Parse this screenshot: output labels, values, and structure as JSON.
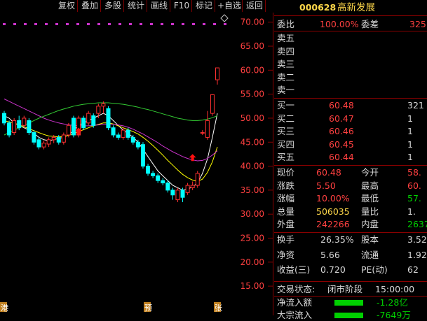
{
  "toolbar": {
    "buttons": [
      "复权",
      "叠加",
      "多股",
      "统计",
      "画线",
      "F10",
      "标记",
      "+自选",
      "返回"
    ]
  },
  "stock": {
    "code": "000628",
    "name": "高新发展"
  },
  "order_book": {
    "webi_label": "委比",
    "webi_value": "100.00%",
    "weicha_label": "委差",
    "weicha_value": "325",
    "asks": [
      {
        "label": "卖五",
        "price": "",
        "vol": ""
      },
      {
        "label": "卖四",
        "price": "",
        "vol": ""
      },
      {
        "label": "卖三",
        "price": "",
        "vol": ""
      },
      {
        "label": "卖二",
        "price": "",
        "vol": ""
      },
      {
        "label": "卖一",
        "price": "",
        "vol": ""
      }
    ],
    "bids": [
      {
        "label": "买一",
        "price": "60.48",
        "vol": "321"
      },
      {
        "label": "买二",
        "price": "60.47",
        "vol": "1"
      },
      {
        "label": "买三",
        "price": "60.46",
        "vol": "1"
      },
      {
        "label": "买四",
        "price": "60.45",
        "vol": "1"
      },
      {
        "label": "买五",
        "price": "60.44",
        "vol": "1"
      }
    ]
  },
  "quote": {
    "rows": [
      {
        "l1": "现价",
        "v1": "60.48",
        "l2": "今开",
        "v2": "58."
      },
      {
        "l1": "涨跌",
        "v1": "5.50",
        "l2": "最高",
        "v2": "60."
      },
      {
        "l1": "涨幅",
        "v1": "10.00%",
        "l2": "最低",
        "v2": "57."
      },
      {
        "l1": "总量",
        "v1": "506035",
        "l2": "量比",
        "v2": "1."
      },
      {
        "l1": "外盘",
        "v1": "242266",
        "l2": "内盘",
        "v2": "2637"
      }
    ]
  },
  "finance": {
    "rows": [
      {
        "l1": "换手",
        "v1": "26.35%",
        "l2": "股本",
        "v2": "3.52"
      },
      {
        "l1": "净资",
        "v1": "5.66",
        "l2": "流通",
        "v2": "1.92"
      },
      {
        "l1": "收益(三)",
        "v1": "0.720",
        "l2": "PE(动)",
        "v2": "62"
      }
    ]
  },
  "status": {
    "label": "交易状态:",
    "state": "闭市阶段",
    "time": "15:00:00"
  },
  "flows": [
    {
      "label": "净流入额",
      "value": "-1.28亿",
      "bar": 0.45
    },
    {
      "label": "大宗流入",
      "value": "-7649万",
      "bar": 0.45
    }
  ],
  "colors": {
    "up": "#ff3030",
    "down": "#00ffff",
    "ma5": "#ffffff",
    "ma10": "#ffff00",
    "ma20": "#cc33cc",
    "ma60": "#33cc33",
    "axis": "#8a0000"
  },
  "chart_data": {
    "type": "candlestick",
    "y_ticks": [
      "70.00",
      "65.00",
      "60.00",
      "55.00",
      "50.00",
      "45.00",
      "40.00",
      "35.00",
      "30.00",
      "25.00",
      "20.00",
      "15.00"
    ],
    "ylim": [
      14,
      72
    ],
    "bottom_labels": [
      "港",
      "预",
      "张"
    ],
    "candles": [
      {
        "o": 51.0,
        "c": 49.0,
        "h": 51.5,
        "l": 48.5
      },
      {
        "o": 49.0,
        "c": 46.5,
        "h": 49.5,
        "l": 46.0
      },
      {
        "o": 47.0,
        "c": 49.5,
        "h": 50.0,
        "l": 46.5
      },
      {
        "o": 49.5,
        "c": 48.0,
        "h": 50.5,
        "l": 47.5
      },
      {
        "o": 48.5,
        "c": 50.0,
        "h": 50.5,
        "l": 48.0
      },
      {
        "o": 49.5,
        "c": 47.0,
        "h": 50.0,
        "l": 46.5
      },
      {
        "o": 47.0,
        "c": 45.0,
        "h": 47.5,
        "l": 44.5
      },
      {
        "o": 45.5,
        "c": 44.0,
        "h": 46.0,
        "l": 43.5
      },
      {
        "o": 44.0,
        "c": 44.8,
        "h": 45.3,
        "l": 43.5
      },
      {
        "o": 44.6,
        "c": 45.5,
        "h": 46.0,
        "l": 44.0
      },
      {
        "o": 45.5,
        "c": 46.0,
        "h": 46.5,
        "l": 44.8
      },
      {
        "o": 46.0,
        "c": 45.0,
        "h": 46.5,
        "l": 44.5
      },
      {
        "o": 45.0,
        "c": 46.5,
        "h": 47.0,
        "l": 44.5
      },
      {
        "o": 46.5,
        "c": 48.5,
        "h": 49.0,
        "l": 46.0
      },
      {
        "o": 50.0,
        "c": 46.5,
        "h": 50.5,
        "l": 46.0
      },
      {
        "o": 46.5,
        "c": 50.0,
        "h": 50.5,
        "l": 46.0
      },
      {
        "o": 50.0,
        "c": 48.0,
        "h": 50.5,
        "l": 47.5
      },
      {
        "o": 49.0,
        "c": 51.0,
        "h": 51.5,
        "l": 48.5
      },
      {
        "o": 50.5,
        "c": 48.5,
        "h": 51.0,
        "l": 48.0
      },
      {
        "o": 51.0,
        "c": 52.5,
        "h": 53.0,
        "l": 50.0
      },
      {
        "o": 52.5,
        "c": 53.0,
        "h": 53.5,
        "l": 51.0
      },
      {
        "o": 52.0,
        "c": 48.0,
        "h": 52.5,
        "l": 47.5
      },
      {
        "o": 48.0,
        "c": 46.5,
        "h": 48.5,
        "l": 46.0
      },
      {
        "o": 46.5,
        "c": 46.0,
        "h": 47.0,
        "l": 45.5
      },
      {
        "o": 46.0,
        "c": 47.5,
        "h": 48.0,
        "l": 45.5
      },
      {
        "o": 47.5,
        "c": 46.0,
        "h": 48.0,
        "l": 45.5
      },
      {
        "o": 46.0,
        "c": 45.0,
        "h": 46.5,
        "l": 44.5
      },
      {
        "o": 45.0,
        "c": 44.0,
        "h": 45.5,
        "l": 43.5
      },
      {
        "o": 44.5,
        "c": 40.0,
        "h": 45.0,
        "l": 39.5
      },
      {
        "o": 40.0,
        "c": 38.5,
        "h": 40.5,
        "l": 38.0
      },
      {
        "o": 38.5,
        "c": 38.0,
        "h": 39.0,
        "l": 37.5
      },
      {
        "o": 38.0,
        "c": 37.0,
        "h": 38.5,
        "l": 36.5
      },
      {
        "o": 37.0,
        "c": 36.5,
        "h": 37.5,
        "l": 36.0
      },
      {
        "o": 36.5,
        "c": 35.0,
        "h": 37.0,
        "l": 34.5
      },
      {
        "o": 35.0,
        "c": 34.0,
        "h": 35.5,
        "l": 33.0
      },
      {
        "o": 33.0,
        "c": 35.0,
        "h": 35.5,
        "l": 32.5
      },
      {
        "o": 35.0,
        "c": 33.5,
        "h": 35.5,
        "l": 32.5
      },
      {
        "o": 34.5,
        "c": 36.0,
        "h": 36.5,
        "l": 34.0
      },
      {
        "o": 35.5,
        "c": 36.0,
        "h": 36.8,
        "l": 35.0
      },
      {
        "o": 36.0,
        "c": 38.5,
        "h": 39.0,
        "l": 35.5
      },
      {
        "o": 47.0,
        "c": 47.0,
        "h": 47.5,
        "l": 46.5
      },
      {
        "o": 46.0,
        "c": 49.5,
        "h": 51.5,
        "l": 45.5
      },
      {
        "o": 51.0,
        "c": 54.9,
        "h": 55.0,
        "l": 50.5
      },
      {
        "o": 58.0,
        "c": 60.48,
        "h": 60.48,
        "l": 57.0
      }
    ],
    "ma_lines": [
      {
        "name": "MA5",
        "values": [
          50.5,
          50.0,
          49.0,
          48.5,
          48.0,
          47.5,
          46.8,
          46.0,
          45.5,
          45.3,
          45.5,
          45.8,
          46.0,
          46.5,
          47.5,
          48.5,
          49.0,
          49.5,
          50.0,
          50.5,
          51.0,
          50.5,
          49.5,
          48.5,
          47.5,
          46.8,
          46.0,
          45.0,
          43.5,
          42.0,
          40.5,
          39.0,
          38.0,
          37.0,
          36.0,
          35.5,
          35.0,
          35.2,
          35.7,
          36.5,
          38.5,
          41.5,
          46.0,
          51.0
        ]
      },
      {
        "name": "MA10",
        "values": [
          49.5,
          49.2,
          49.0,
          48.6,
          48.2,
          47.8,
          47.4,
          47.0,
          46.6,
          46.3,
          46.2,
          46.1,
          46.2,
          46.4,
          46.8,
          47.2,
          47.6,
          48.0,
          48.4,
          48.7,
          49.0,
          49.0,
          48.8,
          48.4,
          48.0,
          47.6,
          47.2,
          46.7,
          46.0,
          45.2,
          44.3,
          43.3,
          42.3,
          41.2,
          40.2,
          39.2,
          38.3,
          37.6,
          37.1,
          36.8,
          37.3,
          38.7,
          40.9,
          44.0
        ]
      },
      {
        "name": "MA20",
        "values": [
          54.0,
          53.5,
          53.0,
          52.5,
          52.0,
          51.5,
          51.0,
          50.5,
          50.0,
          49.6,
          49.3,
          49.0,
          48.8,
          48.6,
          48.5,
          48.4,
          48.4,
          48.4,
          48.5,
          48.6,
          48.7,
          48.8,
          48.7,
          48.6,
          48.4,
          48.1,
          47.7,
          47.2,
          46.7,
          46.1,
          45.5,
          44.9,
          44.2,
          43.6,
          43.0,
          42.5,
          42.0,
          41.6,
          41.3,
          41.1,
          41.2,
          41.6,
          42.3,
          43.2
        ]
      },
      {
        "name": "MA60",
        "values": [
          46.5,
          47.0,
          47.5,
          48.0,
          48.5,
          49.0,
          49.5,
          50.0,
          50.4,
          50.8,
          51.2,
          51.6,
          51.9,
          52.2,
          52.5,
          52.7,
          52.9,
          53.0,
          53.1,
          53.2,
          53.2,
          53.2,
          53.1,
          53.0,
          52.9,
          52.7,
          52.5,
          52.3,
          52.0,
          51.8,
          51.5,
          51.2,
          50.9,
          50.6,
          50.3,
          50.0,
          49.8,
          49.6,
          49.5,
          49.5,
          49.6,
          49.8,
          50.1,
          50.5
        ]
      }
    ]
  }
}
